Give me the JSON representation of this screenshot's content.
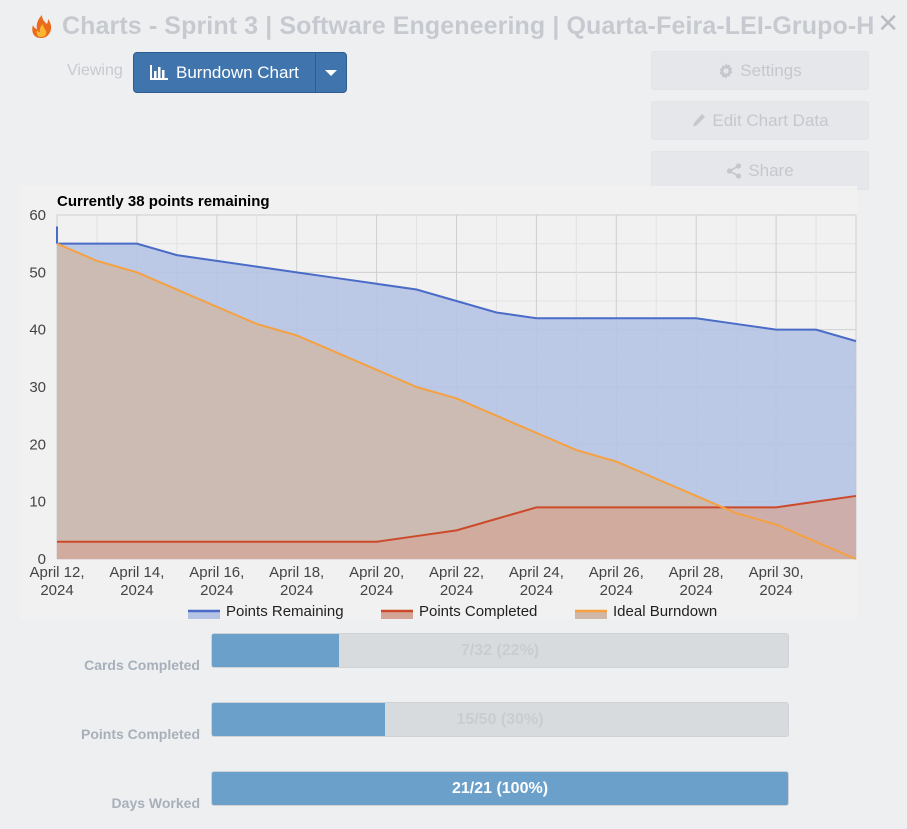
{
  "header": {
    "title": "Charts - Sprint 3 | Software Engeneering | Quarta-Feira-LEI-Grupo-H",
    "close_icon": "close-icon",
    "logo_icon": "flame-logo-icon"
  },
  "toolbar": {
    "viewing_label": "Viewing",
    "view_selector": {
      "label": "Burndown Chart",
      "icon": "bar-chart-icon"
    }
  },
  "actions": {
    "settings": {
      "label": "Settings",
      "icon": "gear-icon"
    },
    "edit": {
      "label": "Edit Chart Data",
      "icon": "pencil-icon"
    },
    "share": {
      "label": "Share",
      "icon": "share-icon"
    }
  },
  "chart_data": {
    "type": "area",
    "title": "Currently 38 points remaining",
    "x": [
      "2024-04-12",
      "2024-04-13",
      "2024-04-14",
      "2024-04-15",
      "2024-04-16",
      "2024-04-17",
      "2024-04-18",
      "2024-04-19",
      "2024-04-20",
      "2024-04-21",
      "2024-04-22",
      "2024-04-23",
      "2024-04-24",
      "2024-04-25",
      "2024-04-26",
      "2024-04-27",
      "2024-04-28",
      "2024-04-29",
      "2024-04-30",
      "2024-05-01",
      "2024-05-02"
    ],
    "tick_labels": [
      [
        "April 12,",
        "2024"
      ],
      [
        "April 14,",
        "2024"
      ],
      [
        "April 16,",
        "2024"
      ],
      [
        "April 18,",
        "2024"
      ],
      [
        "April 20,",
        "2024"
      ],
      [
        "April 22,",
        "2024"
      ],
      [
        "April 24,",
        "2024"
      ],
      [
        "April 26,",
        "2024"
      ],
      [
        "April 28,",
        "2024"
      ],
      [
        "April 30,",
        "2024"
      ]
    ],
    "ylim": [
      0,
      60
    ],
    "yticks": [
      0,
      10,
      20,
      30,
      40,
      50,
      60
    ],
    "grid": true,
    "legend_position": "bottom",
    "series": [
      {
        "name": "Points Remaining",
        "color": "#4a6cc7",
        "fill": "#b5c3e4",
        "values": [
          55,
          55,
          55,
          53,
          52,
          51,
          50,
          49,
          48,
          47,
          45,
          43,
          42,
          42,
          42,
          42,
          42,
          41,
          40,
          40,
          38
        ]
      },
      {
        "name": "Points Completed",
        "color": "#cc4a2a",
        "fill": "#d3a597",
        "values": [
          3,
          3,
          3,
          3,
          3,
          3,
          3,
          3,
          3,
          4,
          5,
          7,
          9,
          9,
          9,
          9,
          9,
          9,
          9,
          10,
          11
        ]
      },
      {
        "name": "Ideal Burndown",
        "color": "#f5a142",
        "fill": "#cfb8a8",
        "values": [
          55,
          52,
          50,
          47,
          44,
          41,
          39,
          36,
          33,
          30,
          28,
          25,
          22,
          19,
          17,
          14,
          11,
          8,
          6,
          3,
          0
        ]
      }
    ],
    "remaining_start_value": 58
  },
  "progress": [
    {
      "label": "Cards Completed",
      "text": "7/32 (22%)",
      "fraction": 0.22
    },
    {
      "label": "Points Completed",
      "text": "15/50 (30%)",
      "fraction": 0.3
    },
    {
      "label": "Days Worked",
      "text": "21/21 (100%)",
      "fraction": 1.0
    }
  ]
}
